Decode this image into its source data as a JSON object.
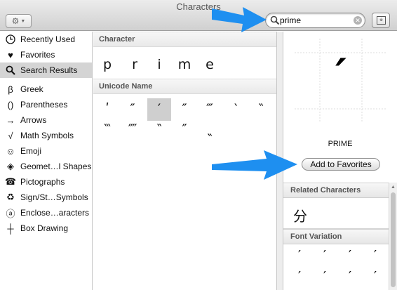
{
  "window": {
    "title": "Characters"
  },
  "toolbar": {
    "action_icon": "gear-icon",
    "search": {
      "value": "prime",
      "placeholder": ""
    },
    "char_view_icon": "character-viewer-icon"
  },
  "sidebar": {
    "items": [
      {
        "label": "Recently Used",
        "icon": "🕒"
      },
      {
        "label": "Favorites",
        "icon": "♥"
      },
      {
        "label": "Search Results",
        "icon": "🔍",
        "selected": true
      },
      {
        "label": "Greek",
        "icon": "β"
      },
      {
        "label": "Parentheses",
        "icon": "()"
      },
      {
        "label": "Arrows",
        "icon": "→"
      },
      {
        "label": "Math Symbols",
        "icon": "√"
      },
      {
        "label": "Emoji",
        "icon": "☺"
      },
      {
        "label": "Geomet…l Shapes",
        "icon": "◈"
      },
      {
        "label": "Pictographs",
        "icon": "☎"
      },
      {
        "label": "Sign/St…Symbols",
        "icon": "♻"
      },
      {
        "label": "Enclose…aracters",
        "icon": "ⓐ"
      },
      {
        "label": "Box Drawing",
        "icon": "┼"
      }
    ]
  },
  "center": {
    "character_header": "Character",
    "word_chars": [
      "p",
      "r",
      "i",
      "m",
      "e"
    ],
    "unicode_header": "Unicode Name",
    "glyph_rows": [
      [
        "ʹ",
        "″",
        "′",
        "″",
        "‴",
        "‵",
        "‶"
      ],
      [
        "‷",
        "⁗",
        "‶",
        "″"
      ],
      [
        "‶"
      ]
    ]
  },
  "right": {
    "preview_glyph": "′",
    "character_name": "PRIME",
    "add_favorites_label": "Add to Favorites",
    "related_header": "Related Characters",
    "related_glyph": "分",
    "font_variation_header": "Font Variation",
    "font_variations": [
      "′",
      "′",
      "′",
      "′",
      "′",
      "′",
      "′",
      "′"
    ]
  },
  "colors": {
    "annotation_arrow": "#1e8ff0",
    "selection": "#d4d4d4"
  }
}
